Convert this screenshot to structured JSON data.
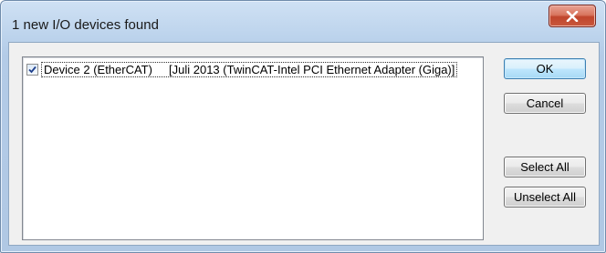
{
  "window": {
    "title": "1 new I/O devices found",
    "close_icon": "close-x-icon"
  },
  "device_list": {
    "items": [
      {
        "checked": true,
        "label": "Device 2 (EtherCAT)     [Juli 2013 (TwinCAT-Intel PCI Ethernet Adapter (Giga)]"
      }
    ]
  },
  "buttons": {
    "ok": "OK",
    "cancel": "Cancel",
    "select_all": "Select All",
    "unselect_all": "Unselect All"
  },
  "colors": {
    "title_bar": "#bcd3ec",
    "close_button": "#c8583d",
    "default_button_border": "#3c7fb1",
    "dialog_background": "#f0f0f0"
  }
}
